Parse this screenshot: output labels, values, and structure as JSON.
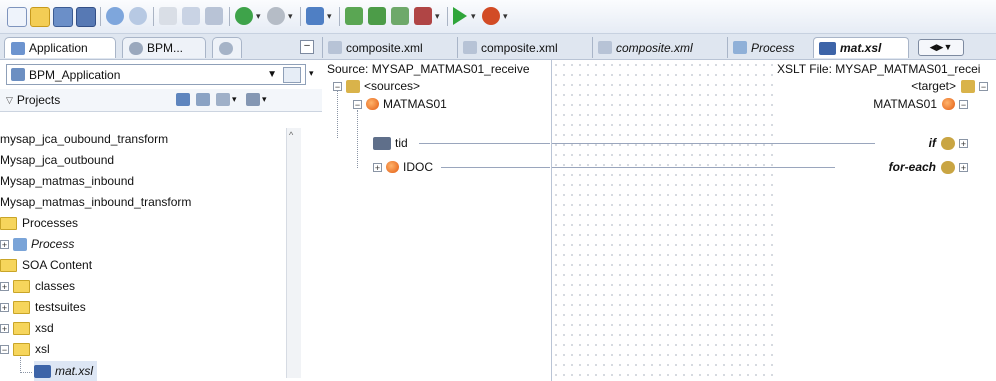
{
  "toolbar": {
    "icons": [
      "new-file-icon",
      "open-folder-icon",
      "save-icon",
      "save-all-icon",
      "undo-icon",
      "redo-icon",
      "cut-icon",
      "copy-icon",
      "paste-icon",
      "back-icon",
      "forward-icon",
      "debug-agent-icon",
      "deploy-icon",
      "compile-icon",
      "build-icon",
      "car-icon",
      "run-icon",
      "debug-bug-icon"
    ]
  },
  "left_panel": {
    "tabs": [
      {
        "label": "Application"
      },
      {
        "label": "BPM..."
      }
    ],
    "application_selector": "BPM_Application",
    "projects_label": "Projects",
    "tree": [
      {
        "label": "mysap_jca_oubound_transform"
      },
      {
        "label": "Mysap_jca_outbound"
      },
      {
        "label": "Mysap_matmas_inbound"
      },
      {
        "label": "Mysap_matmas_inbound_transform"
      },
      {
        "label": "Processes"
      },
      {
        "label": "Process"
      },
      {
        "label": "SOA Content"
      },
      {
        "label": "classes"
      },
      {
        "label": "testsuites"
      },
      {
        "label": "xsd"
      },
      {
        "label": "xsl"
      },
      {
        "label": "mat.xsl"
      }
    ]
  },
  "editor": {
    "tabs": [
      {
        "label": "composite.xml"
      },
      {
        "label": "composite.xml"
      },
      {
        "label": "composite.xml"
      },
      {
        "label": "Process"
      },
      {
        "label": "mat.xsl"
      }
    ],
    "source_header": "Source: MYSAP_MATMAS01_receive",
    "target_header": "XSLT File: MYSAP_MATMAS01_recei",
    "source_tree": [
      "<sources>",
      "MATMAS01",
      "tid",
      "IDOC"
    ],
    "target_tree": [
      "<target>",
      "MATMAS01",
      "if",
      "for-each"
    ]
  },
  "colors": {
    "accent": "#3a67b0",
    "folder": "#f6d55c",
    "element_node": "#e25b12"
  }
}
